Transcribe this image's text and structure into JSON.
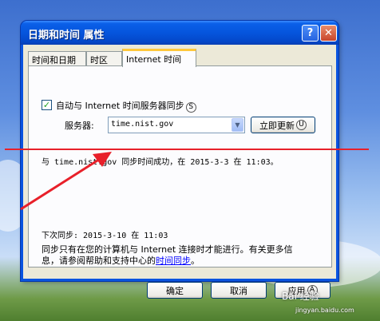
{
  "window": {
    "title": "日期和时间 属性",
    "help_glyph": "?",
    "close_glyph": "✕"
  },
  "tabs": [
    {
      "label": "时间和日期"
    },
    {
      "label": "时区"
    },
    {
      "label": "Internet 时间",
      "active": true
    }
  ],
  "sync": {
    "checkbox_label": "自动与 Internet 时间服务器同步",
    "checkbox_key": "S",
    "checked": true,
    "server_label": "服务器:",
    "server_value": "time.nist.gov",
    "update_button": "立即更新",
    "update_key": "U",
    "status_text": "与 time.nist.gov 同步时间成功，在 2015-3-3 在 11:03。",
    "next_sync": "下次同步: 2015-3-10 在 11:03",
    "info_line1": "同步只有在您的计算机与 Internet 连接时才能进行。有关更多信",
    "info_line2_prefix": "息，请参阅帮助和支持中心的",
    "info_link": "时间同步",
    "info_line2_suffix": "。"
  },
  "footer": {
    "ok": "确定",
    "cancel": "取消",
    "apply": "应用",
    "apply_key": "A"
  },
  "watermark": {
    "brand": "Bai 经验",
    "url": "jingyan.baidu.com"
  },
  "annotation_colors": {
    "arrow": "#e8202a"
  }
}
